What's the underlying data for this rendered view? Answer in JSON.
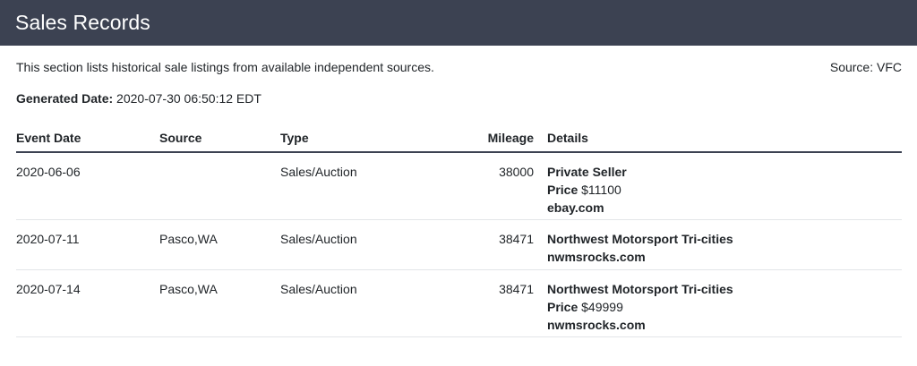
{
  "header": {
    "title": "Sales Records"
  },
  "intro": {
    "text": "This section lists historical sale listings from available independent sources.",
    "source": "Source: VFC"
  },
  "generated": {
    "label": "Generated Date:",
    "value": "2020-07-30 06:50:12 EDT"
  },
  "table": {
    "columns": {
      "event_date": "Event Date",
      "source": "Source",
      "type": "Type",
      "mileage": "Mileage",
      "details": "Details"
    },
    "rows": [
      {
        "event_date": "2020-06-06",
        "source": "",
        "type": "Sales/Auction",
        "mileage": "38000",
        "seller": "Private Seller",
        "price_label": "Price",
        "price": "$11100",
        "site": "ebay.com"
      },
      {
        "event_date": "2020-07-11",
        "source": "Pasco,WA",
        "type": "Sales/Auction",
        "mileage": "38471",
        "seller": "Northwest Motorsport Tri-cities",
        "site": "nwmsrocks.com"
      },
      {
        "event_date": "2020-07-14",
        "source": "Pasco,WA",
        "type": "Sales/Auction",
        "mileage": "38471",
        "seller": "Northwest Motorsport Tri-cities",
        "price_label": "Price",
        "price": "$49999",
        "site": "nwmsrocks.com"
      }
    ]
  },
  "colors": {
    "header_bg": "#3c4252",
    "header_text": "#ffffff",
    "body_text": "#212529",
    "row_divider": "#e3e5e8"
  }
}
